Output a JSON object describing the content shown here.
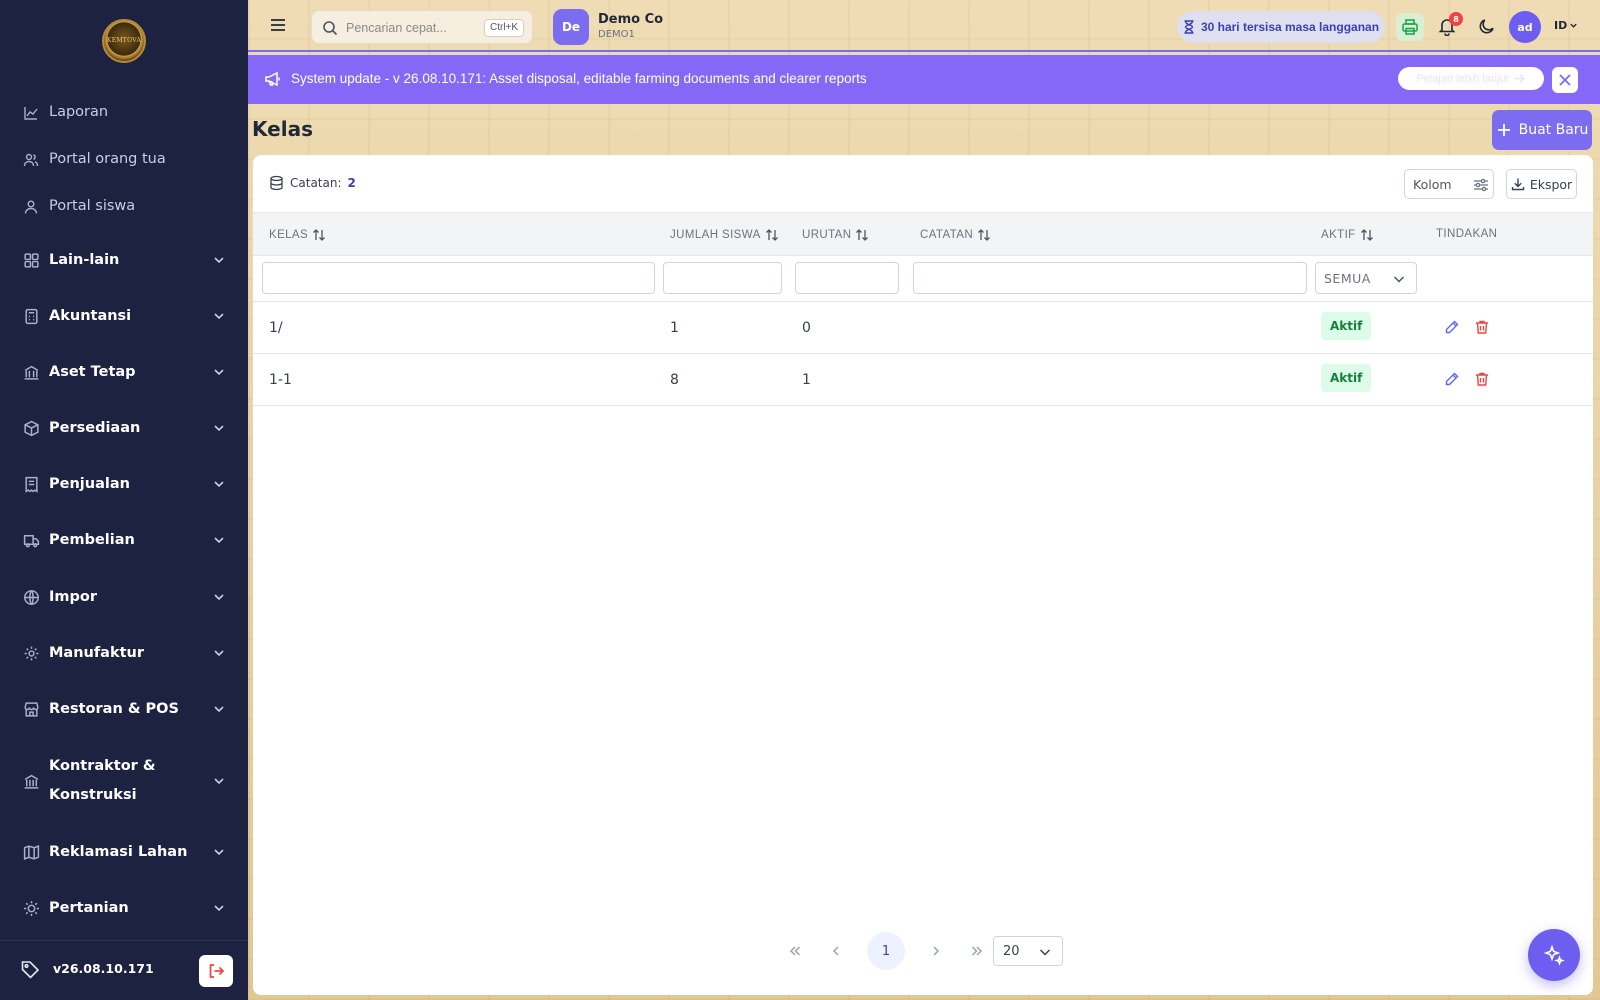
{
  "sidebar": {
    "logo_text": "KEMTOVA",
    "items": [
      {
        "label": "Laporan",
        "icon": "chart-line-icon"
      },
      {
        "label": "Portal orang tua",
        "icon": "users-icon"
      },
      {
        "label": "Portal siswa",
        "icon": "user-icon"
      }
    ],
    "groups": [
      {
        "label": "Lain-lain",
        "icon": "grid-icon"
      },
      {
        "label": "Akuntansi",
        "icon": "calculator-icon"
      },
      {
        "label": "Aset Tetap",
        "icon": "bank-icon"
      },
      {
        "label": "Persediaan",
        "icon": "box-icon"
      },
      {
        "label": "Penjualan",
        "icon": "receipt-icon"
      },
      {
        "label": "Pembelian",
        "icon": "truck-icon"
      },
      {
        "label": "Impor",
        "icon": "globe-icon"
      },
      {
        "label": "Manufaktur",
        "icon": "cog-icon"
      },
      {
        "label": "Restoran & POS",
        "icon": "store-icon"
      },
      {
        "label": "Kontraktor &",
        "label2": "Konstruksi",
        "icon": "building-icon"
      },
      {
        "label": "Reklamasi Lahan",
        "icon": "map-icon"
      },
      {
        "label": "Pertanian",
        "icon": "sun-icon"
      }
    ],
    "version": "v26.08.10.171"
  },
  "topbar": {
    "search_placeholder": "Pencarian cepat...",
    "search_shortcut": "Ctrl+K",
    "company_initials": "De",
    "company_name": "Demo Co",
    "company_code": "DEMO1",
    "subscription": "30 hari tersisa masa langganan",
    "notifications_count": "8",
    "user_initials": "ad",
    "language": "ID"
  },
  "announcement": {
    "message": "System update - v 26.08.10.171: Asset disposal, editable farming documents and clearer reports",
    "learn_more": "Pelajari lebih lanjut"
  },
  "page": {
    "title": "Kelas",
    "new_button": "Buat Baru"
  },
  "toolbar": {
    "records_label": "Catatan:",
    "records_count": "2",
    "columns_button": "Kolom",
    "export_button": "Ekspor"
  },
  "table": {
    "headers": [
      "KELAS",
      "JUMLAH SISWA",
      "URUTAN",
      "CATATAN",
      "AKTIF",
      "TINDAKAN"
    ],
    "active_filter": "SEMUA",
    "rows": [
      {
        "kelas": "1/",
        "jumlah_siswa": "1",
        "urutan": "0",
        "catatan": "",
        "aktif": "Aktif"
      },
      {
        "kelas": "1-1",
        "jumlah_siswa": "8",
        "urutan": "1",
        "catatan": "",
        "aktif": "Aktif"
      }
    ]
  },
  "pagination": {
    "current_page": "1",
    "page_size": "20"
  },
  "colors": {
    "sidebar_bg": "#1c2240",
    "accent": "#7c6cf0",
    "announcement_bg": "#8569f6",
    "active_badge_bg": "#dcfce7",
    "active_badge_text": "#15803d",
    "delete_red": "#ef4444"
  }
}
